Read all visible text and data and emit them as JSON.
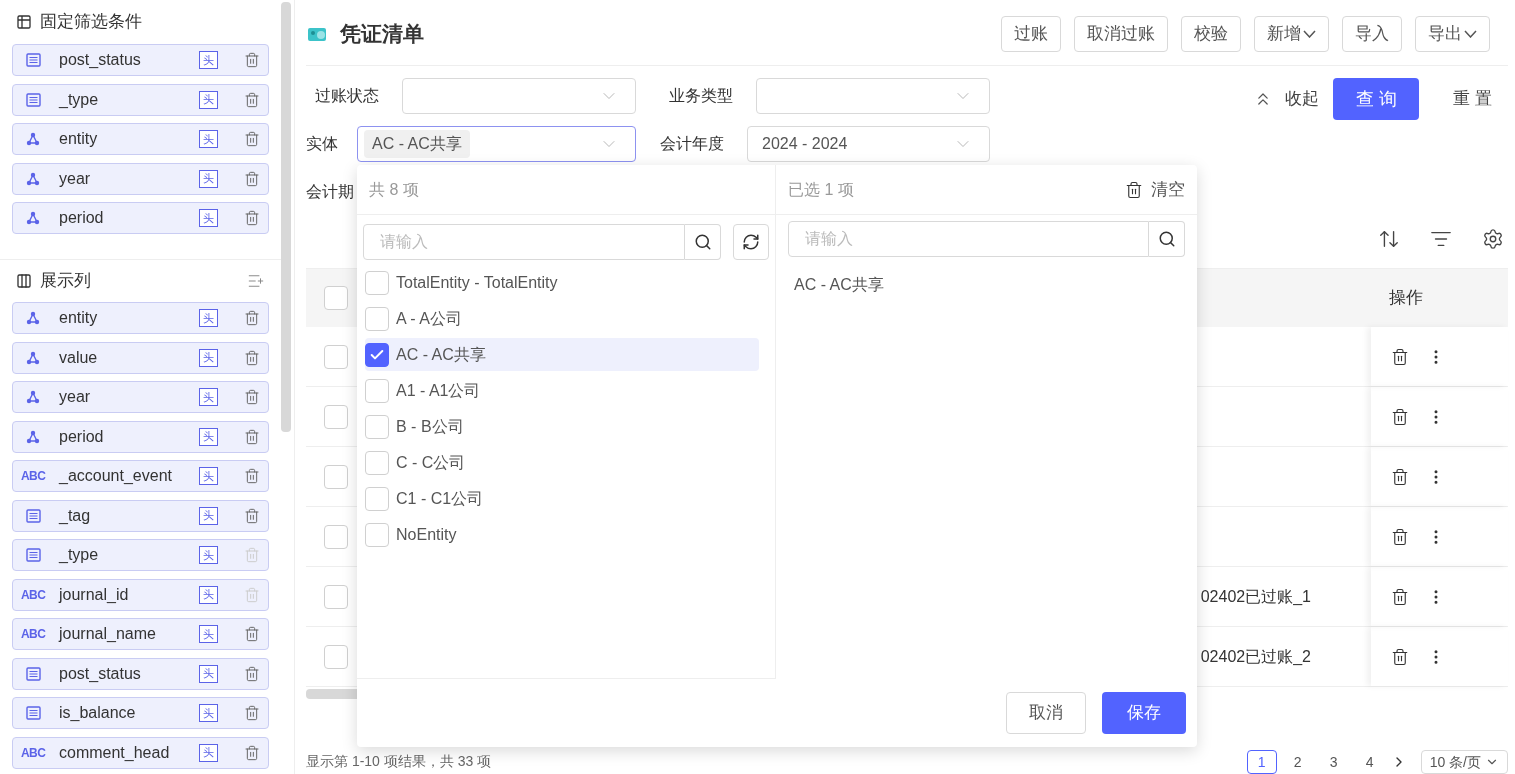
{
  "sidebar": {
    "fixed_filters": {
      "title": "固定筛选条件",
      "items": [
        {
          "kind": "list",
          "name": "post_status",
          "tag": "头",
          "disabled": false
        },
        {
          "kind": "list",
          "name": "_type",
          "tag": "头",
          "disabled": false
        },
        {
          "kind": "dimension",
          "name": "entity",
          "tag": "头",
          "disabled": false
        },
        {
          "kind": "dimension",
          "name": "year",
          "tag": "头",
          "disabled": false
        },
        {
          "kind": "dimension",
          "name": "period",
          "tag": "头",
          "disabled": false
        }
      ]
    },
    "display_columns": {
      "title": "展示列",
      "items": [
        {
          "kind": "dimension",
          "name": "entity",
          "tag": "头",
          "disabled": false
        },
        {
          "kind": "dimension",
          "name": "value",
          "tag": "头",
          "disabled": false
        },
        {
          "kind": "dimension",
          "name": "year",
          "tag": "头",
          "disabled": false
        },
        {
          "kind": "dimension",
          "name": "period",
          "tag": "头",
          "disabled": false
        },
        {
          "kind": "text",
          "icon_text": "ABC",
          "name": "_account_event",
          "tag": "头",
          "disabled": false
        },
        {
          "kind": "list",
          "name": "_tag",
          "tag": "头",
          "disabled": false
        },
        {
          "kind": "list",
          "name": "_type",
          "tag": "头",
          "disabled": true
        },
        {
          "kind": "text",
          "icon_text": "ABC",
          "name": "journal_id",
          "tag": "头",
          "disabled": true
        },
        {
          "kind": "text",
          "icon_text": "ABC",
          "name": "journal_name",
          "tag": "头",
          "disabled": false
        },
        {
          "kind": "list",
          "name": "post_status",
          "tag": "头",
          "disabled": false
        },
        {
          "kind": "list",
          "name": "is_balance",
          "tag": "头",
          "disabled": false
        },
        {
          "kind": "text",
          "icon_text": "ABC",
          "name": "comment_head",
          "tag": "头",
          "disabled": false
        }
      ]
    }
  },
  "header": {
    "title": "凭证清单",
    "buttons": [
      {
        "label": "过账",
        "dropdown": false
      },
      {
        "label": "取消过账",
        "dropdown": false
      },
      {
        "label": "校验",
        "dropdown": false
      },
      {
        "label": "新增",
        "dropdown": true
      },
      {
        "label": "导入",
        "dropdown": false
      },
      {
        "label": "导出",
        "dropdown": true
      }
    ]
  },
  "filters": {
    "post_status": {
      "label": "过账状态"
    },
    "business_type": {
      "label": "业务类型"
    },
    "entity": {
      "label": "实体",
      "value": "AC - AC共享",
      "focused": true
    },
    "year": {
      "label": "会计年度",
      "value": "2024 - 2024"
    },
    "period": {
      "label": "会计期"
    },
    "collapse": "收起",
    "query": "查 询",
    "reset": "重 置"
  },
  "table": {
    "header_checked": false,
    "action_header": "操作",
    "rows": [
      {
        "checked": false,
        "cell": ""
      },
      {
        "checked": false,
        "cell": ""
      },
      {
        "checked": false,
        "cell": ""
      },
      {
        "checked": false,
        "cell": ""
      },
      {
        "checked": false,
        "cell": "02402已过账_1"
      },
      {
        "checked": false,
        "cell": "02402已过账_2"
      }
    ]
  },
  "popover": {
    "count": "共 8 项",
    "search_placeholder": "请输入",
    "items": [
      {
        "label": "TotalEntity - TotalEntity",
        "checked": false,
        "selected": false
      },
      {
        "label": "A - A公司",
        "checked": false,
        "selected": false
      },
      {
        "label": "AC - AC共享",
        "checked": true,
        "selected": true
      },
      {
        "label": "A1 - A1公司",
        "checked": false,
        "selected": false
      },
      {
        "label": "B - B公司",
        "checked": false,
        "selected": false
      },
      {
        "label": "C - C公司",
        "checked": false,
        "selected": false
      },
      {
        "label": "C1 - C1公司",
        "checked": false,
        "selected": false
      },
      {
        "label": "NoEntity",
        "checked": false,
        "selected": false
      }
    ],
    "selected_count": "已选 1 项",
    "clear": "清空",
    "selected_placeholder": "请输入",
    "selected_items": [
      "AC - AC共享"
    ],
    "cancel": "取消",
    "save": "保存"
  },
  "pagination": {
    "summary": "显示第 1-10 项结果，共 33 项",
    "pages": [
      {
        "label": "1",
        "selected": true
      },
      {
        "label": "2",
        "selected": false
      },
      {
        "label": "3",
        "selected": false
      },
      {
        "label": "4",
        "selected": false
      }
    ],
    "page_size": "10 条/页"
  }
}
